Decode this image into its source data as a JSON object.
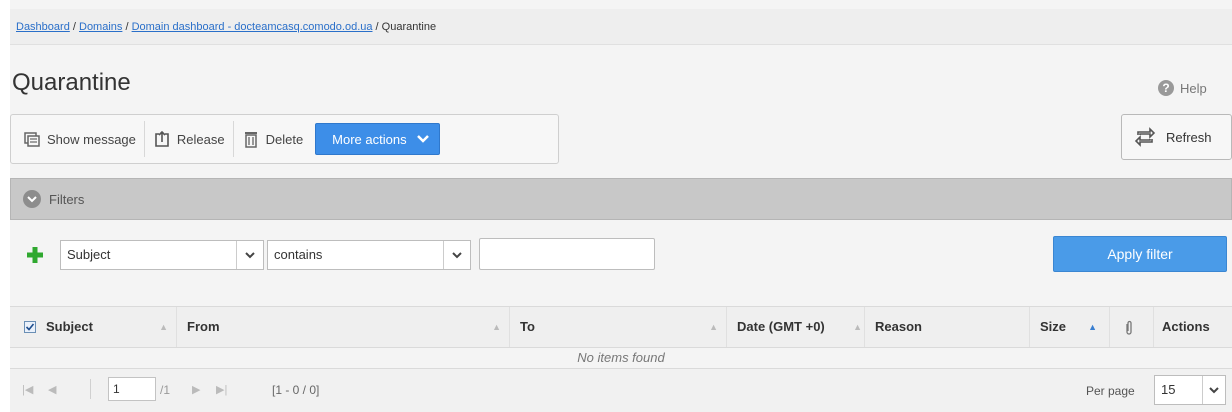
{
  "breadcrumb": {
    "items": [
      "Dashboard",
      "Domains",
      "Domain dashboard - docteamcasq.comodo.od.ua"
    ],
    "separator": " / ",
    "current": "Quarantine"
  },
  "page": {
    "title": "Quarantine",
    "help_label": "Help"
  },
  "toolbar": {
    "show_message": "Show message",
    "release": "Release",
    "delete": "Delete",
    "more_actions": "More actions",
    "refresh": "Refresh"
  },
  "filters": {
    "label": "Filters",
    "field_select": "Subject",
    "operator_select": "contains",
    "value": "",
    "apply": "Apply filter"
  },
  "table": {
    "columns": [
      "Subject",
      "From",
      "To",
      "Date (GMT +0)",
      "Reason",
      "Size",
      "Actions"
    ],
    "empty_message": "No items found"
  },
  "pager": {
    "page": "1",
    "total_pages": "/1",
    "range": "[1 - 0 / 0]",
    "per_page_label": "Per page",
    "per_page_value": "15"
  },
  "colors": {
    "accent": "#3d8ee8",
    "apply_button": "#4a9be8",
    "add_icon": "#2fa82f",
    "link": "#2a6fc9"
  },
  "icons": [
    "message-icon",
    "release-icon",
    "trash-icon",
    "chevron-down-icon",
    "refresh-icon",
    "help-icon",
    "plus-icon",
    "paperclip-icon",
    "first-page-icon",
    "prev-page-icon",
    "next-page-icon",
    "last-page-icon"
  ]
}
